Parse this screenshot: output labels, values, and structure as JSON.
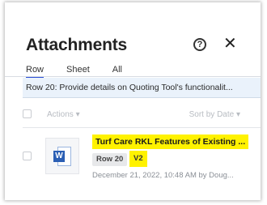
{
  "panel": {
    "title": "Attachments",
    "help_symbol": "?",
    "close_symbol": "✕"
  },
  "tabs": [
    {
      "label": "Row",
      "active": true
    },
    {
      "label": "Sheet",
      "active": false
    },
    {
      "label": "All",
      "active": false
    }
  ],
  "row_banner": "Row 20: Provide details on Quoting Tool's functionalit...",
  "toolbar": {
    "actions_label": "Actions ▾",
    "sort_label": "Sort by Date ▾"
  },
  "attachment": {
    "file_icon": "word-document-icon",
    "file_icon_letter": "W",
    "name": "Turf Care RKL Features of Existing ...",
    "row_tag": "Row 20",
    "version_tag": "V2",
    "meta": "December 21, 2022, 10:48 AM by Doug..."
  },
  "colors": {
    "highlight": "#fff200",
    "active_tab": "#2c4fd6",
    "banner_bg": "#eaf2fb",
    "word_blue": "#2b5fb4"
  }
}
